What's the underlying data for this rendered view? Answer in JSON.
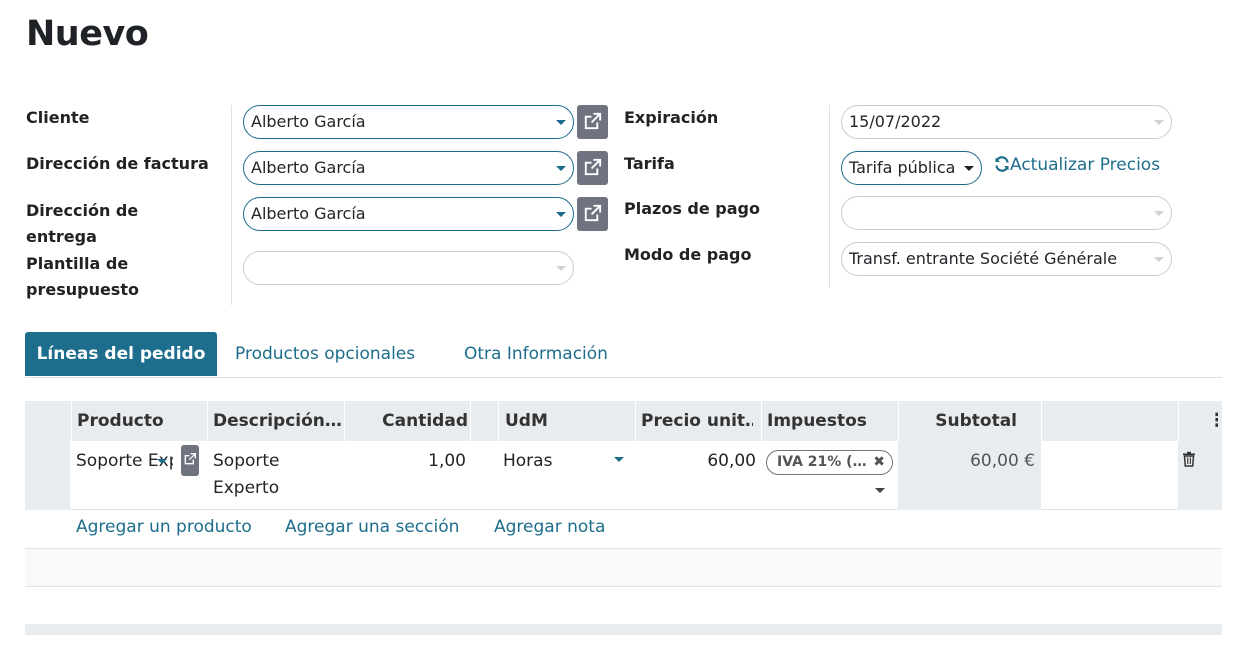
{
  "page": {
    "title": "Nuevo"
  },
  "form": {
    "left": [
      {
        "label": "Cliente",
        "value": "Alberto García"
      },
      {
        "label": "Dirección de factura",
        "value": "Alberto García"
      },
      {
        "label_line1": "Dirección de",
        "label_line2": "entrega",
        "value": "Alberto García"
      },
      {
        "label_line1": "Plantilla de",
        "label_line2": "presupuesto",
        "value": ""
      }
    ],
    "right": [
      {
        "label": "Expiración",
        "value": "15/07/2022"
      },
      {
        "label": "Tarifa",
        "value": "Tarifa pública",
        "action": "Actualizar Precios"
      },
      {
        "label": "Plazos de pago",
        "value": ""
      },
      {
        "label": "Modo de pago",
        "value": "Transf. entrante Société Générale"
      }
    ]
  },
  "tabs": [
    "Líneas del pedido",
    "Productos opcionales",
    "Otra Información"
  ],
  "table": {
    "headers": [
      "Producto",
      "Descripción…",
      "Cantidad",
      "UdM",
      "Precio unit…",
      "Impuestos",
      "Subtotal"
    ],
    "rows": [
      {
        "producto": "Soporte Experto",
        "descripcion_line1": "Soporte",
        "descripcion_line2": "Experto",
        "cantidad": "1,00",
        "udm": "Horas",
        "precio": "60,00",
        "impuesto": "IVA 21% (…",
        "subtotal": "60,00 €"
      }
    ],
    "actions": [
      "Agregar un producto",
      "Agregar una sección",
      "Agregar nota"
    ]
  },
  "colors": {
    "accent": "#1d6d8c",
    "button": "#6f7380",
    "header_bg": "#e9ecef"
  }
}
